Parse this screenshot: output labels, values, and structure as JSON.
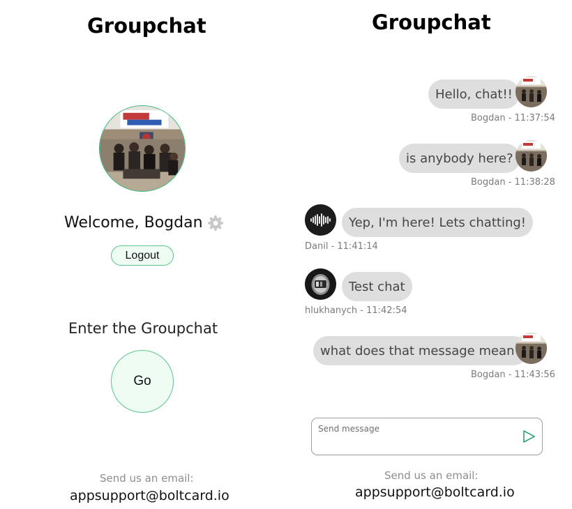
{
  "app": {
    "title_left": "Groupchat",
    "title_right": "Groupchat",
    "accent_color": "#2eb87a",
    "button_bg": "#effcf4"
  },
  "profile": {
    "welcome_text": "Welcome, Bogdan",
    "settings_icon": "gear-icon",
    "logout_label": "Logout"
  },
  "entry": {
    "title": "Enter the Groupchat",
    "go_label": "Go"
  },
  "footer": {
    "label": "Send us an email:",
    "email": "appsupport@boltcard.io"
  },
  "chat": {
    "messages": [
      {
        "text": "Hello, chat!!",
        "author": "Bogdan",
        "time": "11:37:54",
        "meta": "Bogdan - 11:37:54",
        "own": true,
        "avatar": "group-photo-avatar"
      },
      {
        "text": "is anybody here?",
        "author": "Bogdan",
        "time": "11:38:28",
        "meta": "Bogdan - 11:38:28",
        "own": true,
        "avatar": "group-photo-avatar"
      },
      {
        "text": "Yep, I'm here! Lets chatting!",
        "author": "Danil",
        "time": "11:41:14",
        "meta": "Danil - 11:41:14",
        "own": false,
        "avatar": "waveform-avatar"
      },
      {
        "text": "Test chat",
        "author": "hlukhanych",
        "time": "11:42:54",
        "meta": "hlukhanych - 11:42:54",
        "own": false,
        "avatar": "helmet-avatar"
      },
      {
        "text": "what does that message mean?",
        "author": "Bogdan",
        "time": "11:43:56",
        "meta": "Bogdan - 11:43:56",
        "own": true,
        "avatar": "group-photo-avatar"
      }
    ],
    "composer": {
      "placeholder": "Send message",
      "value": "",
      "send_icon": "send-icon"
    },
    "bubble_color": "#dedede"
  }
}
